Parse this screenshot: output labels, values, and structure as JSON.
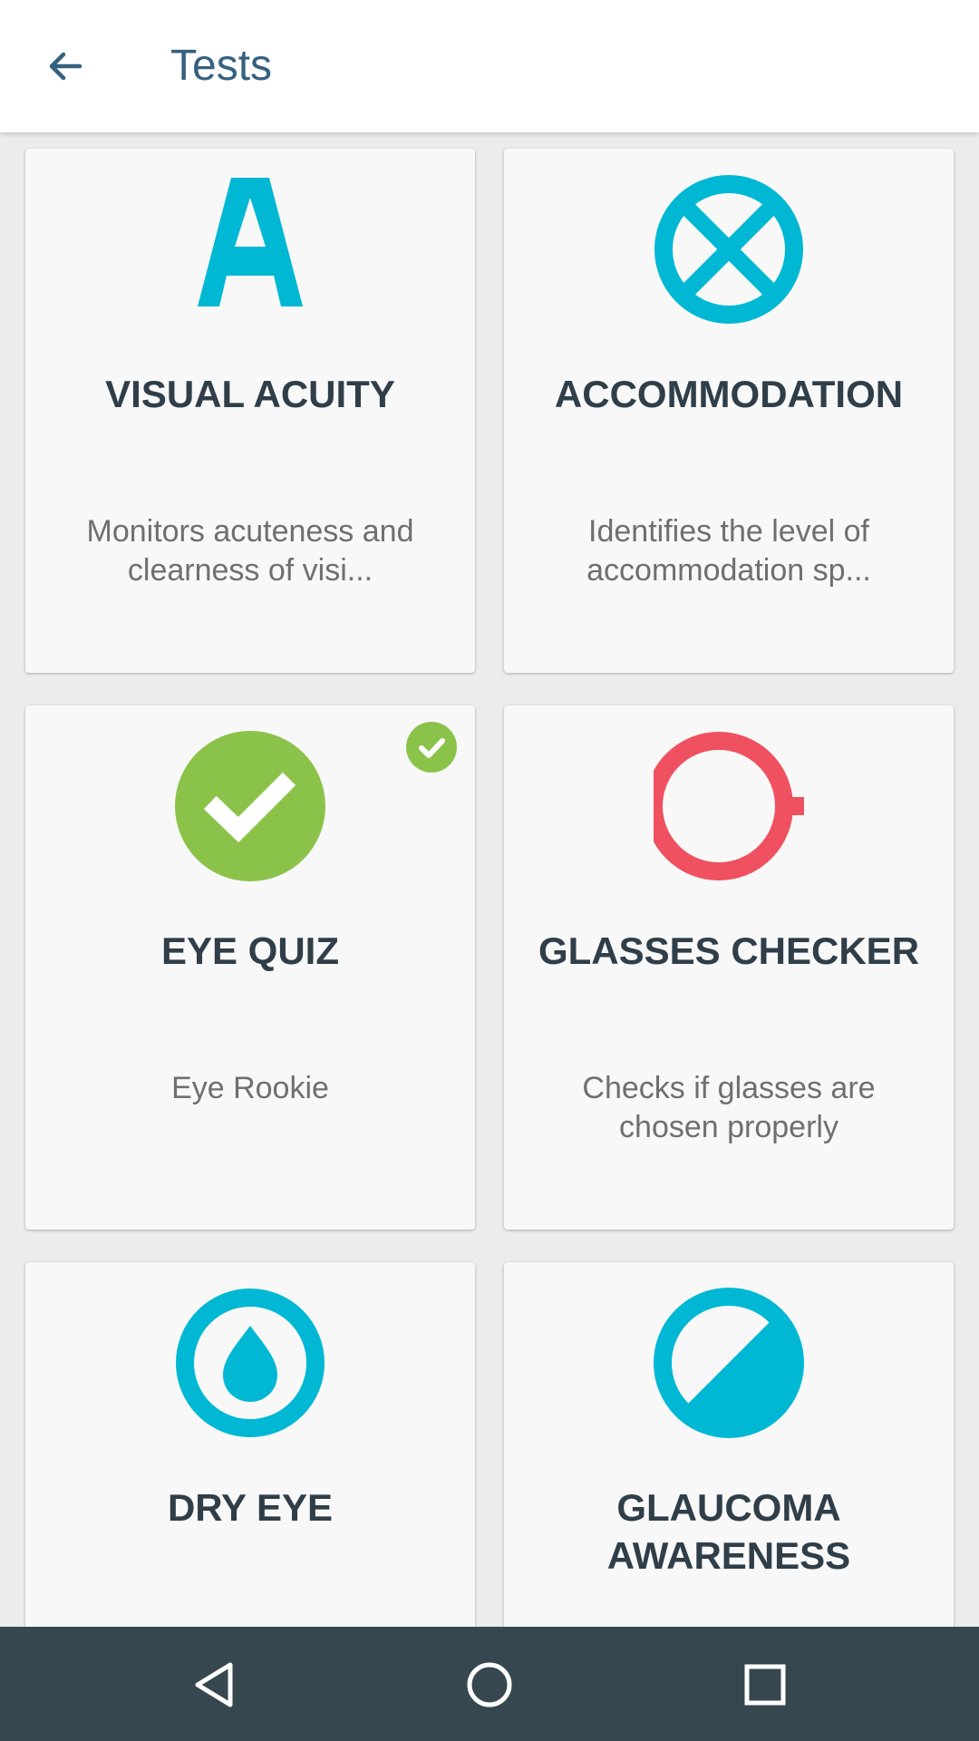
{
  "app_bar": {
    "title": "Tests",
    "back_icon": "arrow-left-icon"
  },
  "colors": {
    "app_bar_text": "#35607f",
    "accent_cyan": "#00b8d4",
    "success_green": "#8bc34a",
    "alert_red": "#ef5160",
    "title_text": "#2f3e48",
    "desc_text": "#6f6f6f",
    "nav_bar": "#37474f"
  },
  "tests": [
    {
      "title": "VISUAL ACUITY",
      "description": "Monitors acuteness and clearness of visi...",
      "icon": "letter-a-icon",
      "completed": false
    },
    {
      "title": "ACCOMMODATION",
      "description": "Identifies the level of accommodation sp...",
      "icon": "circle-cross-icon",
      "completed": false
    },
    {
      "title": "EYE QUIZ",
      "description": "Eye Rookie",
      "icon": "check-circle-icon",
      "completed": true
    },
    {
      "title": "GLASSES CHECKER",
      "description": "Checks if glasses are chosen properly",
      "icon": "ring-tab-icon",
      "completed": false
    },
    {
      "title": "DRY EYE",
      "description": "",
      "icon": "water-drop-ring-icon",
      "completed": false
    },
    {
      "title": "GLAUCOMA AWARENESS",
      "description": "",
      "icon": "half-filled-circle-icon",
      "completed": false
    }
  ],
  "nav_bar": {
    "back_icon": "triangle-back-icon",
    "home_icon": "circle-home-icon",
    "recents_icon": "square-recents-icon"
  }
}
